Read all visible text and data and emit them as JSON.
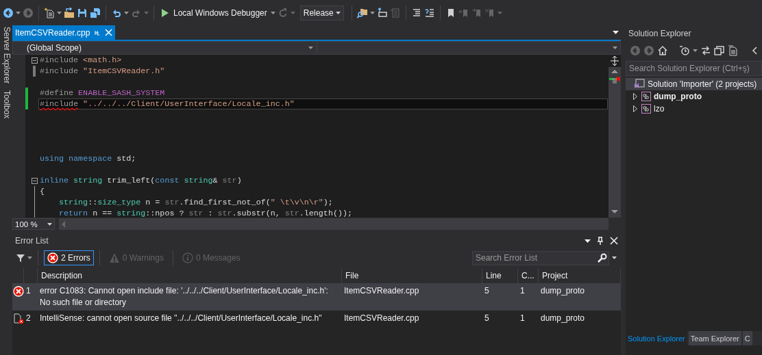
{
  "toolbar": [
    {
      "kind": "back",
      "disabled": false,
      "caret": true
    },
    {
      "kind": "forward",
      "disabled": true,
      "caret": false
    },
    {
      "kind": "separator"
    },
    {
      "kind": "new-project",
      "disabled": false,
      "caret": true
    },
    {
      "kind": "open",
      "disabled": false,
      "caret": false
    },
    {
      "kind": "save",
      "disabled": false,
      "caret": false
    },
    {
      "kind": "save-all",
      "disabled": false,
      "caret": false
    },
    {
      "kind": "separator"
    },
    {
      "kind": "undo",
      "disabled": false,
      "caret": true
    },
    {
      "kind": "redo",
      "disabled": true,
      "caret": true
    },
    {
      "kind": "separator"
    },
    {
      "kind": "start",
      "label": "Local Windows Debugger",
      "disabled": false,
      "caret": true
    },
    {
      "kind": "restart",
      "disabled": true,
      "caret": true
    },
    {
      "kind": "combo",
      "value": "Release"
    },
    {
      "kind": "separator"
    },
    {
      "kind": "find",
      "disabled": false,
      "caret": true
    },
    {
      "kind": "step",
      "disabled": false,
      "caret": false
    },
    {
      "kind": "step-out",
      "disabled": true,
      "caret": false
    },
    {
      "kind": "separator"
    },
    {
      "kind": "comment",
      "disabled": false,
      "caret": false
    },
    {
      "kind": "uncomment",
      "disabled": false,
      "caret": false
    },
    {
      "kind": "separator"
    },
    {
      "kind": "bookmark",
      "disabled": false,
      "caret": false
    },
    {
      "kind": "bookmark-prev",
      "disabled": true,
      "caret": false
    },
    {
      "kind": "bookmark-next",
      "disabled": true,
      "caret": false
    },
    {
      "kind": "bookmark-clear",
      "disabled": true,
      "caret": true
    }
  ],
  "side_strip": [
    "Server Explorer",
    "Toolbox"
  ],
  "editor": {
    "tabs": [
      {
        "label": "ItemCSVReader.cpp",
        "selected": true
      }
    ],
    "scope": "(Global Scope)",
    "lines": [
      {
        "kind": "code",
        "collapsed": false,
        "changed": false,
        "current": false,
        "tokens": [
          {
            "text": "#include",
            "kind": "directive"
          },
          {
            "text": " <math.h>",
            "kind": "string"
          }
        ]
      },
      {
        "kind": "code",
        "changed": false,
        "current": false,
        "tokens": [
          {
            "text": "#include",
            "kind": "directive"
          },
          {
            "text": " \"ItemCSVReader.h\"",
            "kind": "string"
          }
        ]
      },
      {
        "kind": "blank"
      },
      {
        "kind": "code",
        "changed": true,
        "current": false,
        "tokens": [
          {
            "text": "#define ",
            "kind": "directive"
          },
          {
            "text": "ENABLE_SASH_SYSTEM",
            "kind": "macro"
          }
        ]
      },
      {
        "kind": "code",
        "changed": true,
        "current": true,
        "tokens": [
          {
            "text": "#include",
            "kind": "directive",
            "squiggle": true
          },
          {
            "text": " \"../../../Client/UserInterface/Locale_inc.h\"",
            "kind": "string"
          }
        ]
      },
      {
        "kind": "blank"
      },
      {
        "kind": "blank"
      },
      {
        "kind": "blank"
      },
      {
        "kind": "blank"
      },
      {
        "kind": "code",
        "changed": false,
        "current": false,
        "tokens": [
          {
            "text": "using",
            "kind": "keyword"
          },
          {
            "text": " namespace",
            "kind": "keyword"
          },
          {
            "text": " std;",
            "kind": "plain"
          }
        ]
      },
      {
        "kind": "blank"
      },
      {
        "kind": "code",
        "collapsed": false,
        "changed": false,
        "current": false,
        "tokens": [
          {
            "text": "inline",
            "kind": "keyword"
          },
          {
            "text": " string",
            "kind": "type"
          },
          {
            "text": " trim_left(",
            "kind": "plain"
          },
          {
            "text": "const",
            "kind": "keyword"
          },
          {
            "text": " string",
            "kind": "type"
          },
          {
            "text": "& ",
            "kind": "plain"
          },
          {
            "text": "str",
            "kind": "param"
          },
          {
            "text": ")",
            "kind": "plain"
          }
        ]
      },
      {
        "kind": "code",
        "changed": false,
        "current": false,
        "tokens": [
          {
            "text": "{",
            "kind": "plain"
          }
        ]
      },
      {
        "kind": "code",
        "changed": false,
        "current": false,
        "tokens": [
          {
            "text": "    string",
            "kind": "type"
          },
          {
            "text": "::",
            "kind": "plain"
          },
          {
            "text": "size_type",
            "kind": "type"
          },
          {
            "text": " n = ",
            "kind": "plain"
          },
          {
            "text": "str",
            "kind": "param"
          },
          {
            "text": ".find_first_not_of(",
            "kind": "plain"
          },
          {
            "text": "\" \\t\\v\\n\\r\"",
            "kind": "string"
          },
          {
            "text": ");",
            "kind": "plain"
          }
        ]
      },
      {
        "kind": "code",
        "changed": false,
        "current": false,
        "tokens": [
          {
            "text": "    return",
            "kind": "keyword"
          },
          {
            "text": " n == ",
            "kind": "plain"
          },
          {
            "text": "string",
            "kind": "type"
          },
          {
            "text": "::npos ? ",
            "kind": "plain"
          },
          {
            "text": "str",
            "kind": "param"
          },
          {
            "text": " : ",
            "kind": "plain"
          },
          {
            "text": "str",
            "kind": "param"
          },
          {
            "text": ".substr(n, ",
            "kind": "plain"
          },
          {
            "text": "str",
            "kind": "param"
          },
          {
            "text": ".length());",
            "kind": "plain"
          }
        ]
      }
    ],
    "zoom": "100 %"
  },
  "error_list": {
    "title": "Error List",
    "filters": [
      {
        "kind": "error",
        "label": "2 Errors",
        "selected": true,
        "disabled": false
      },
      {
        "kind": "warning",
        "label": "0 Warnings",
        "selected": false,
        "disabled": true
      },
      {
        "kind": "info",
        "label": "0 Messages",
        "selected": false,
        "disabled": true
      }
    ],
    "search": {
      "placeholder": "Search Error List"
    },
    "columns": [
      "Description",
      "File",
      "Line",
      "C...",
      "Project"
    ],
    "rows": [
      {
        "kind": "error",
        "number": "1",
        "description": "error C1083: Cannot open include file: '../../../Client/UserInterface/Locale_inc.h': No such file or directory",
        "file": "ItemCSVReader.cpp",
        "line": "5",
        "column": "1",
        "project": "dump_proto",
        "selected": true
      },
      {
        "kind": "intellisense",
        "number": "2",
        "description": "IntelliSense: cannot open source file \"../../../Client/UserInterface/Locale_inc.h\"",
        "file": "ItemCSVReader.cpp",
        "line": "5",
        "column": "1",
        "project": "dump_proto",
        "selected": false
      }
    ]
  },
  "solution_explorer": {
    "title": "Solution Explorer",
    "toolbar": [
      {
        "kind": "back",
        "disabled": true,
        "caret": false
      },
      {
        "kind": "forward",
        "disabled": true,
        "caret": false
      },
      {
        "kind": "home",
        "disabled": false,
        "caret": false
      },
      {
        "kind": "separator"
      },
      {
        "kind": "history",
        "disabled": false,
        "caret": true
      },
      {
        "kind": "sync",
        "disabled": false,
        "caret": false
      },
      {
        "kind": "collapse",
        "disabled": false,
        "caret": false
      },
      {
        "kind": "show-all",
        "disabled": false,
        "caret": false
      },
      {
        "kind": "separator"
      },
      {
        "kind": "chevron",
        "disabled": false,
        "caret": false
      }
    ],
    "search": {
      "placeholder": "Search Solution Explorer (Ctrl+ş)"
    },
    "tree": [
      {
        "kind": "solution",
        "label": "Solution 'Importer' (2 projects)",
        "selected": true,
        "startup": false,
        "children": [
          {
            "kind": "project",
            "label": "dump_proto",
            "selected": false,
            "startup": true,
            "expanded": false
          },
          {
            "kind": "project",
            "label": "lzo",
            "selected": false,
            "startup": false,
            "expanded": false
          }
        ]
      }
    ],
    "bottom_tabs": [
      {
        "label": "Solution Explorer",
        "selected": true
      },
      {
        "label": "Team Explorer",
        "selected": false
      },
      {
        "label": "C",
        "selected": false
      }
    ]
  }
}
